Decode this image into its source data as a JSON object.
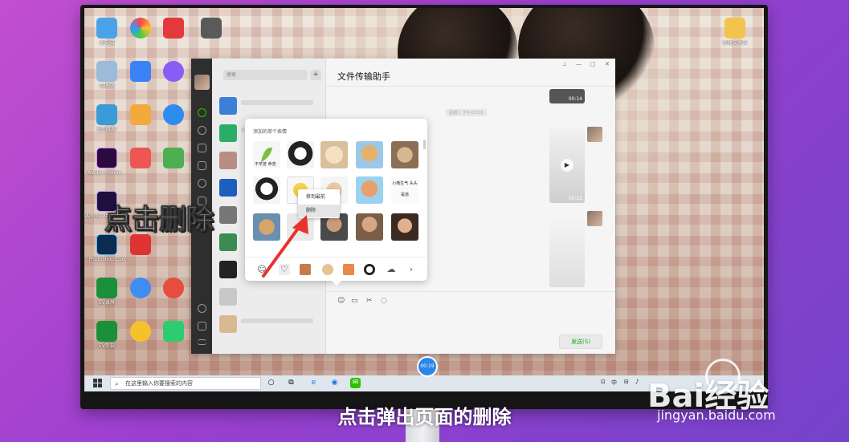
{
  "desktop": {
    "icons": [
      {
        "label": "此电脑",
        "color": "#4aa3e6"
      },
      {
        "label": "回收站",
        "color": "#9bbbd8"
      },
      {
        "label": "控制面板",
        "color": "#3b9bd8"
      },
      {
        "label": "Adobe Premie...",
        "color": "#2a0a3f"
      },
      {
        "label": "Adobe After Effects",
        "color": "#1f0f3d"
      },
      {
        "label": "Photoshop CS6",
        "color": "#0b2b4f"
      },
      {
        "label": "EV录屏",
        "color": "#1c8f3a"
      },
      {
        "label": "EV剪辑",
        "color": "#1c8f3a"
      }
    ],
    "folder_label": "新建文件夹"
  },
  "wechat": {
    "search_placeholder": "搜索",
    "plus_label": "+",
    "chat_title": "文件传输助手",
    "time_tag": "星期二 下午 03:16",
    "video_durations": [
      "00:14",
      "00:12"
    ],
    "send_label": "发送(S)"
  },
  "sticker_panel": {
    "title": "添加的单个表情",
    "captions": [
      "不辛苦 命苦",
      "小熊生气 头头是道"
    ]
  },
  "context_menu": {
    "items": [
      "移到最前",
      "删除"
    ]
  },
  "taskbar": {
    "search_placeholder": "在这里输入你要搜索的内容",
    "tray_text": "中"
  },
  "recording_timer": "00:19",
  "annotation": "点击删除",
  "caption": "点击弹出页面的删除",
  "watermark": {
    "logo": "Bai经验",
    "url": "jingyan.baidu.com"
  }
}
